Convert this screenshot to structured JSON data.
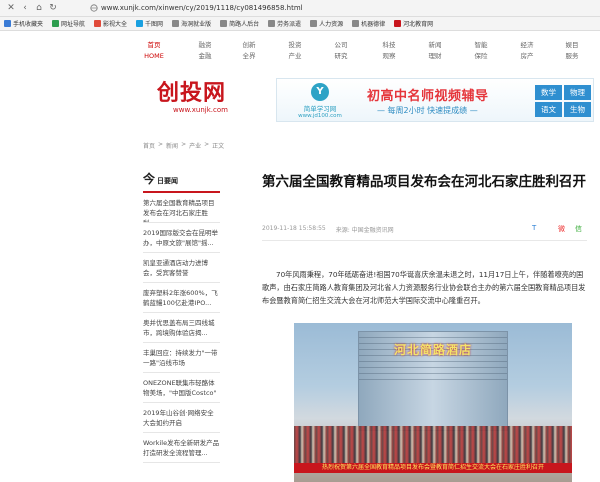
{
  "browser": {
    "url": "www.xunjk.com/xinwen/cy/2019/1118/cy081496858.html",
    "bookmarks": [
      {
        "label": "手机收藏夹",
        "color": "#3a7bd5"
      },
      {
        "label": "网址导航",
        "color": "#2e9e4f"
      },
      {
        "label": "影视大全",
        "color": "#e04a3a"
      },
      {
        "label": "千图网",
        "color": "#1aa0e0"
      },
      {
        "label": "海洞就业版",
        "color": "#888888"
      },
      {
        "label": "简路人后台",
        "color": "#888888"
      },
      {
        "label": "劳务派遣",
        "color": "#888888"
      },
      {
        "label": "人力资源",
        "color": "#888888"
      },
      {
        "label": "机器德律",
        "color": "#888888"
      },
      {
        "label": "河北教育网",
        "color": "#c8161d"
      }
    ]
  },
  "nav": [
    {
      "l1": "首页",
      "l2": "HOME"
    },
    {
      "l1": "融资",
      "l2": "金融"
    },
    {
      "l1": "创新",
      "l2": "全界"
    },
    {
      "l1": "投资",
      "l2": "产业"
    },
    {
      "l1": "公司",
      "l2": "研究"
    },
    {
      "l1": "科技",
      "l2": "观察"
    },
    {
      "l1": "新闻",
      "l2": "理财"
    },
    {
      "l1": "智能",
      "l2": "保险"
    },
    {
      "l1": "经济",
      "l2": "房产"
    },
    {
      "l1": "娱目",
      "l2": "服务"
    }
  ],
  "logo": {
    "text": "创投网",
    "url": "www.xunjk.com"
  },
  "banner": {
    "brand": "简单学习网",
    "brand_url": "www.jd100.com",
    "brand_icon": "Y",
    "title": "初高中名师视频辅导",
    "subtitle": "— 每周2小时 快速提成绩 —",
    "subjects": [
      {
        "label": "数学",
        "color": "#2f8fd0"
      },
      {
        "label": "物理",
        "color": "#2f8fd0"
      },
      {
        "label": "语文",
        "color": "#2f8fd0"
      },
      {
        "label": "生物",
        "color": "#2f8fd0"
      }
    ]
  },
  "breadcrumb": [
    "首页",
    "新闻",
    "产业",
    "正文"
  ],
  "sidebar": {
    "head_big": "今",
    "head_small": "日要闻",
    "items": [
      "第六届全国教育精品项目发布会在河北石家庄胜利...",
      "2019国际版交会在昆明举办，中原文旅\"展馆\"摇...",
      "凯皇亚通酒店动力进博会，受宾客赞誉",
      "废弃塑料2年涨600%，飞鹤蓝鳗100亿赴港IPO...",
      "奥并优思盖布局三四线城市，跨境购体验店揭...",
      "丰巢回应：持续发力\"一带一路\"沿线市场",
      "ONEZONE联集市轻酪体物美场，\"中国版Costco\"",
      "2019年山谷创·网络安全大会如约开启",
      "Workile发布全新研发产品 打造研发全流程管理..."
    ]
  },
  "article": {
    "title": "第六届全国教育精品项目发布会在河北石家庄胜利召开",
    "date": "2019-11-18 15:58:55",
    "source": "来源: 中国金融资讯网",
    "share": {
      "t": "T",
      "weibo": "微",
      "wechat": "信"
    },
    "paragraph": "70年风雨秉程，70年砥砺奋进!祖国70华诞喜庆余温未退之时，11月17日上午，伴随着嘹亮的国歌声，由石家庄简路人教育集团及河北省人力资源服务行业协会联合主办的第六届全国教育精品项目发布会暨教育简仁招生交流大会在河北师范大学国际交流中心隆重召开。",
    "photo_sign": "河北简路酒店",
    "photo_banner": "热烈祝贺第六届全国教育精品项目发布会暨教育简仁招生交流大会在石家庄胜利召开"
  }
}
